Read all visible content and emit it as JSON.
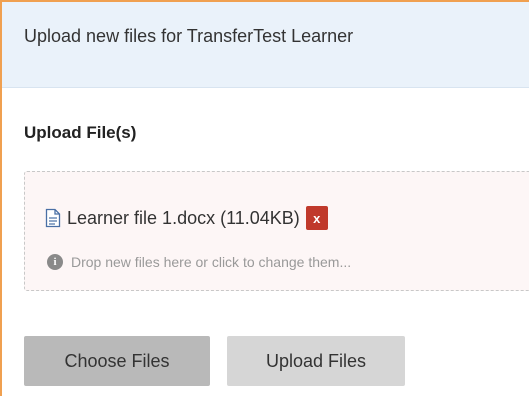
{
  "header": {
    "title": "Upload new files for TransferTest Learner"
  },
  "section": {
    "title": "Upload File(s)"
  },
  "dropzone": {
    "file_name": "Learner file 1.docx (11.04KB)",
    "remove_label": "x",
    "hint": "Drop new files here or click to change them..."
  },
  "buttons": {
    "choose": "Choose Files",
    "upload": "Upload Files"
  },
  "colors": {
    "header_bg": "#eaf2fa",
    "panel_border": "#f0a050",
    "remove_btn": "#c0392b",
    "dropzone_bg": "#fdf6f6"
  },
  "icons": {
    "file": "file-document-icon",
    "info": "info-circle-icon"
  }
}
